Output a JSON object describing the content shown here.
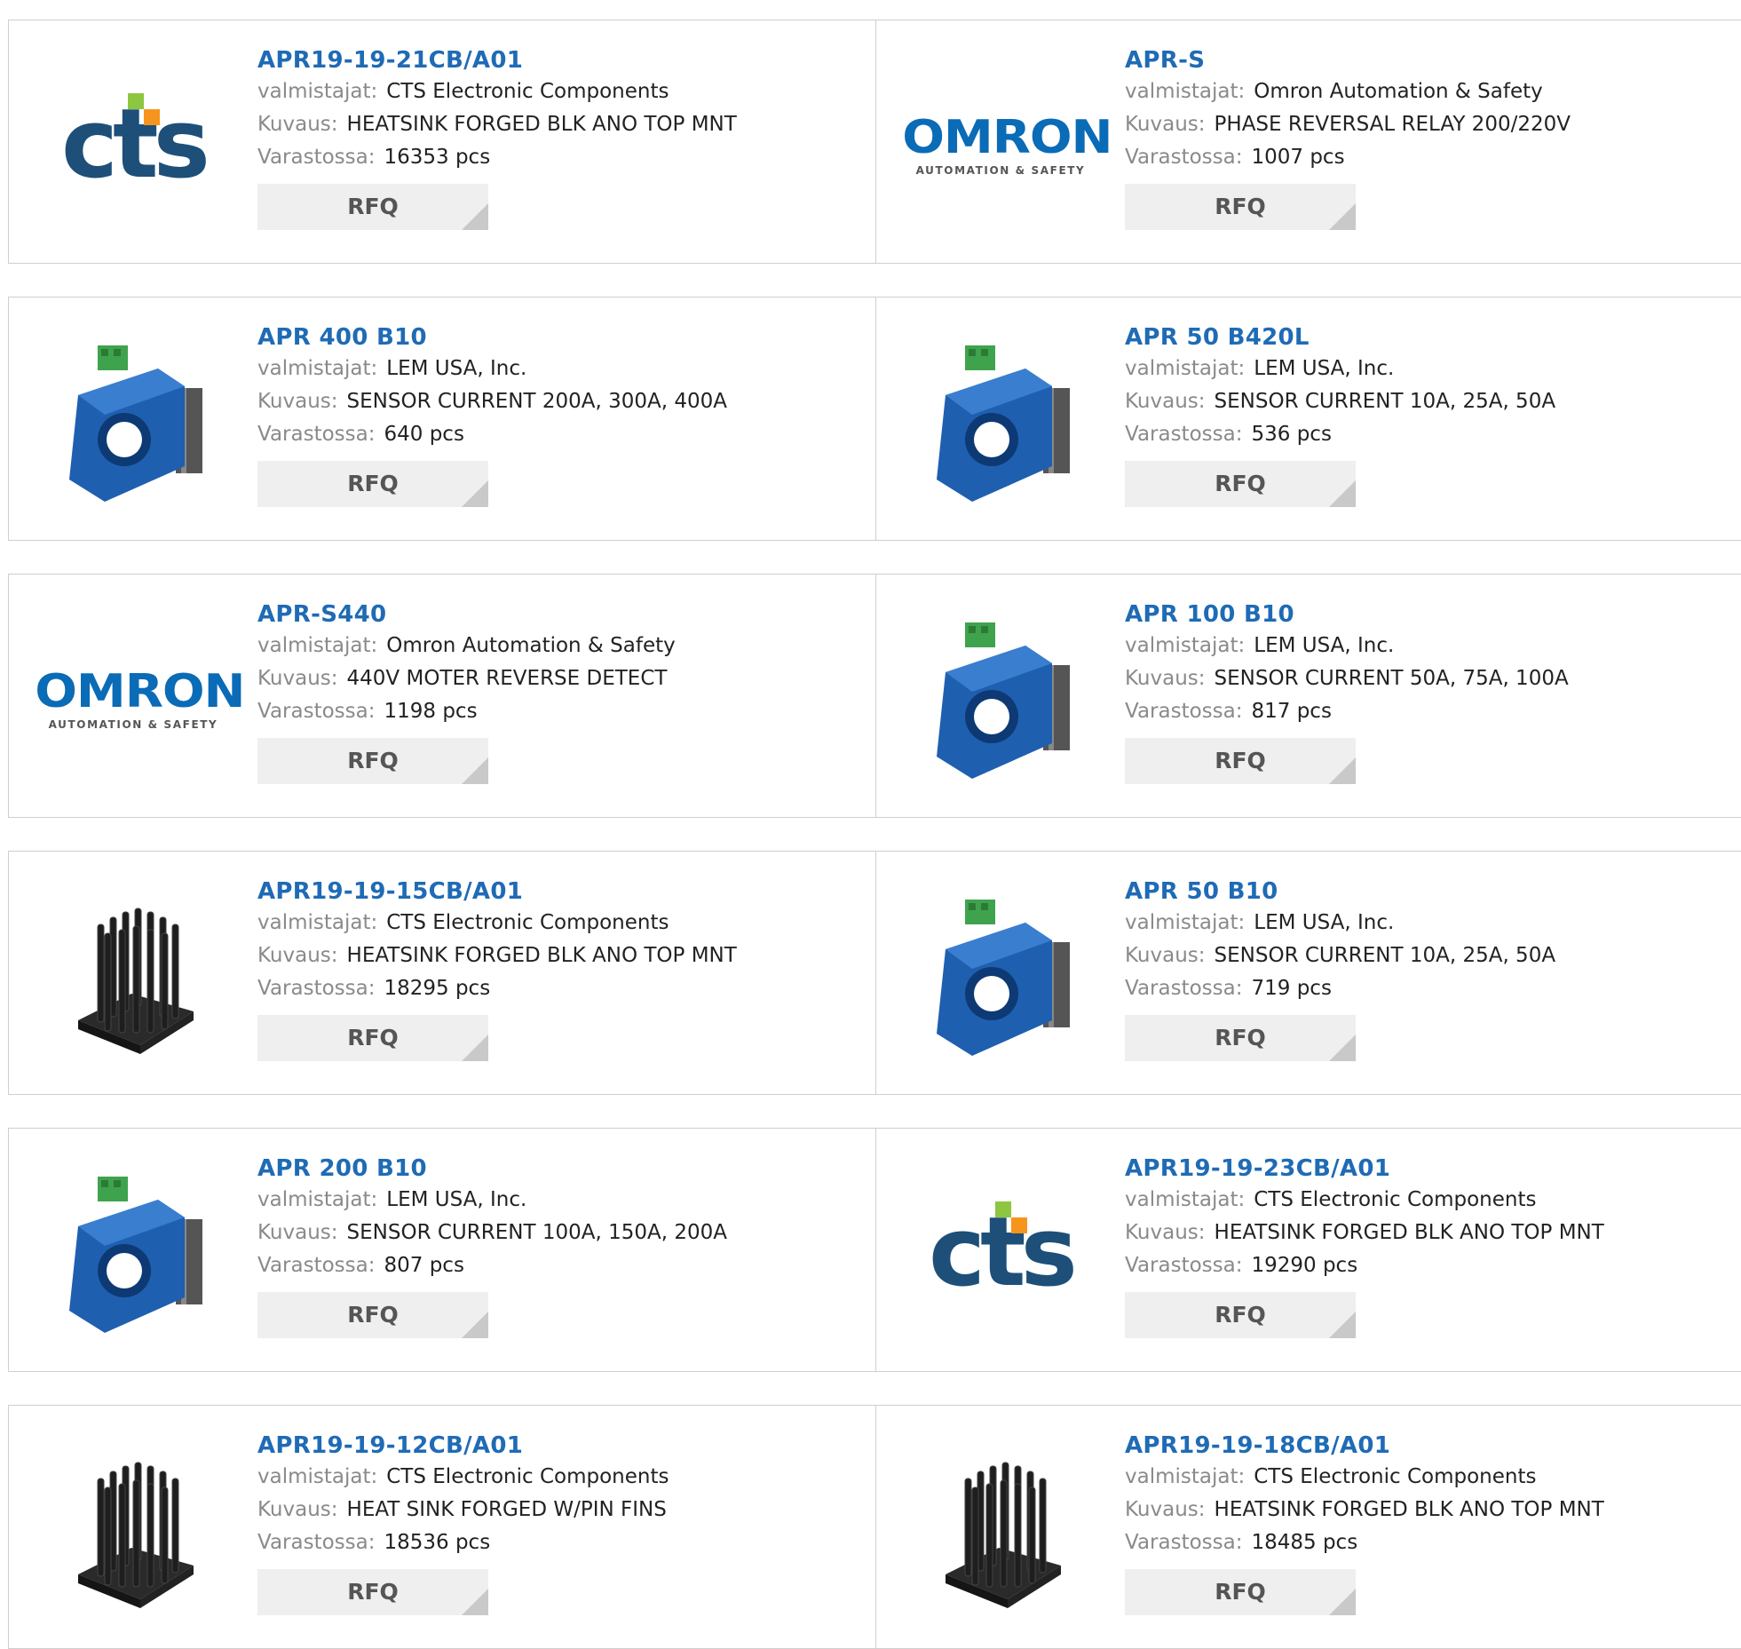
{
  "labels": {
    "manufacturer": "valmistajat:",
    "description": "Kuvaus:",
    "stock": "Varastossa:",
    "rfq": "RFQ"
  },
  "logos": {
    "cts_text": "cts",
    "omron_word": "OMRON",
    "omron_sub": "AUTOMATION & SAFETY"
  },
  "colors": {
    "part_link": "#1f6bb5",
    "button_bg": "#efefef",
    "cts_blue": "#1d4f79",
    "omron_blue": "#0a6bb6"
  },
  "products": [
    {
      "part": "APR19-19-21CB/A01",
      "manufacturer": "CTS Electronic Components",
      "description": "HEATSINK FORGED BLK ANO TOP MNT",
      "stock": "16353 pcs",
      "image": "cts-logo"
    },
    {
      "part": "APR-S",
      "manufacturer": "Omron Automation & Safety",
      "description": "PHASE REVERSAL RELAY 200/220V",
      "stock": "1007 pcs",
      "image": "omron-logo"
    },
    {
      "part": "APR 400 B10",
      "manufacturer": "LEM USA, Inc.",
      "description": "SENSOR CURRENT 200A, 300A, 400A",
      "stock": "640 pcs",
      "image": "current-sensor"
    },
    {
      "part": "APR 50 B420L",
      "manufacturer": "LEM USA, Inc.",
      "description": "SENSOR CURRENT 10A, 25A, 50A",
      "stock": "536 pcs",
      "image": "current-sensor"
    },
    {
      "part": "APR-S440",
      "manufacturer": "Omron Automation & Safety",
      "description": "440V MOTER REVERSE DETECT",
      "stock": "1198 pcs",
      "image": "omron-logo"
    },
    {
      "part": "APR 100 B10",
      "manufacturer": "LEM USA, Inc.",
      "description": "SENSOR CURRENT 50A, 75A, 100A",
      "stock": "817 pcs",
      "image": "current-sensor"
    },
    {
      "part": "APR19-19-15CB/A01",
      "manufacturer": "CTS Electronic Components",
      "description": "HEATSINK FORGED BLK ANO TOP MNT",
      "stock": "18295 pcs",
      "image": "pin-heatsink"
    },
    {
      "part": "APR 50 B10",
      "manufacturer": "LEM USA, Inc.",
      "description": "SENSOR CURRENT 10A, 25A, 50A",
      "stock": "719 pcs",
      "image": "current-sensor"
    },
    {
      "part": "APR 200 B10",
      "manufacturer": "LEM USA, Inc.",
      "description": "SENSOR CURRENT 100A, 150A, 200A",
      "stock": "807 pcs",
      "image": "current-sensor"
    },
    {
      "part": "APR19-19-23CB/A01",
      "manufacturer": "CTS Electronic Components",
      "description": "HEATSINK FORGED BLK ANO TOP MNT",
      "stock": "19290 pcs",
      "image": "cts-logo"
    },
    {
      "part": "APR19-19-12CB/A01",
      "manufacturer": "CTS Electronic Components",
      "description": "HEAT SINK FORGED W/PIN FINS",
      "stock": "18536 pcs",
      "image": "pin-heatsink"
    },
    {
      "part": "APR19-19-18CB/A01",
      "manufacturer": "CTS Electronic Components",
      "description": "HEATSINK FORGED BLK ANO TOP MNT",
      "stock": "18485 pcs",
      "image": "pin-heatsink"
    }
  ]
}
